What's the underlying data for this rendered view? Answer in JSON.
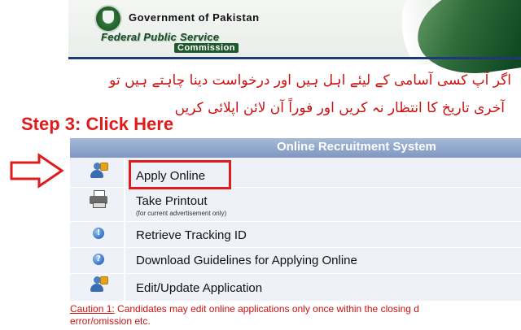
{
  "header": {
    "government_title": "Government of Pakistan",
    "commission_line1": "Federal Public Service",
    "commission_line2": "Commission"
  },
  "notice": {
    "urdu_line1": "اگر آپ کسی آسامی کے لیئے اہل ہیں اور درخواست دینا چاہتے ہیں تو",
    "urdu_line2": "آخری تاریخ کا انتظار نہ کریں اور فوراً آن لائن اپلائی کریں"
  },
  "step_label": "Step 3: Click Here",
  "panel": {
    "title": "Online Recruitment System",
    "items": [
      {
        "label": "Apply Online",
        "icon": "user-shield-icon"
      },
      {
        "label": "Take Printout",
        "sub": "(for current advertisement only)",
        "icon": "printer-icon"
      },
      {
        "label": "Retrieve Tracking ID",
        "icon": "info-icon"
      },
      {
        "label": "Download Guidelines for Applying Online",
        "icon": "help-icon"
      },
      {
        "label": "Edit/Update Application",
        "icon": "user-shield-icon"
      }
    ]
  },
  "caution": {
    "label": "Caution 1:",
    "text": " Candidates may edit online applications only once within the closing d",
    "text_line2": "error/omission etc."
  },
  "colors": {
    "accent_red": "#e11b1b",
    "panel_header": "#7f97c2",
    "panel_bg": "#eef2f8",
    "header_rule": "#1c3a7a"
  }
}
